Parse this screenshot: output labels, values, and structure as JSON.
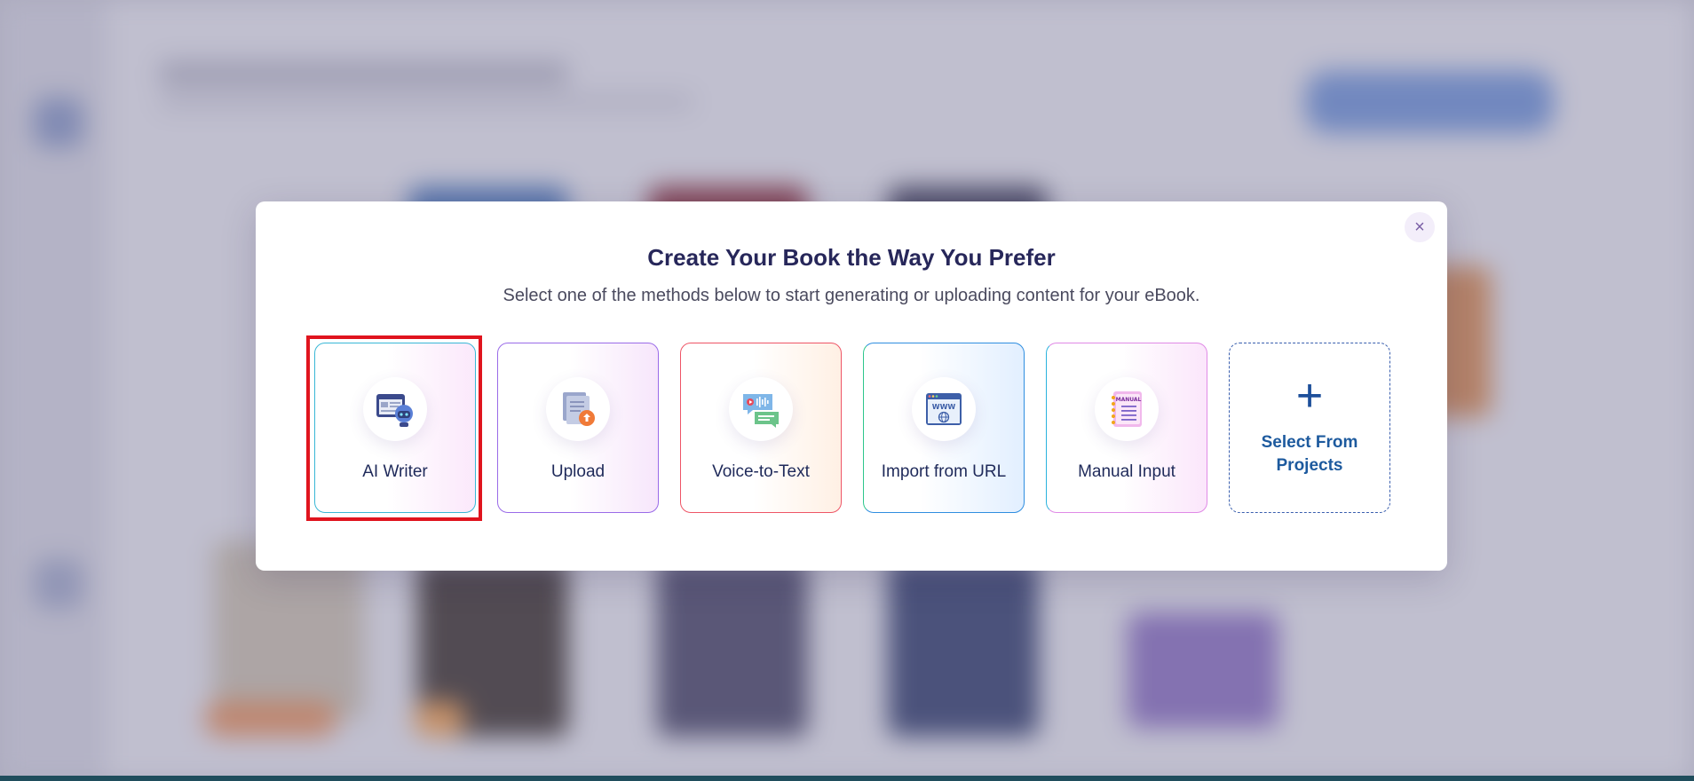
{
  "modal": {
    "title": "Create Your Book the Way You Prefer",
    "subtitle": "Select one of the methods below to start generating or uploading content for your eBook.",
    "close_icon": "close-icon",
    "close_label": "×"
  },
  "options": [
    {
      "label": "AI Writer",
      "icon": "ai-writer-icon",
      "selected": true
    },
    {
      "label": "Upload",
      "icon": "upload-icon"
    },
    {
      "label": "Voice-to-Text",
      "icon": "voice-to-text-icon"
    },
    {
      "label": "Import from URL",
      "icon": "www-icon"
    },
    {
      "label": "Manual Input",
      "icon": "manual-notebook-icon"
    },
    {
      "label": "Select From Projects",
      "icon": "plus-icon",
      "icon_glyph": "+"
    }
  ],
  "colors": {
    "title": "#27275a",
    "highlight": "#e0141e",
    "projects_accent": "#1d4f9a"
  }
}
